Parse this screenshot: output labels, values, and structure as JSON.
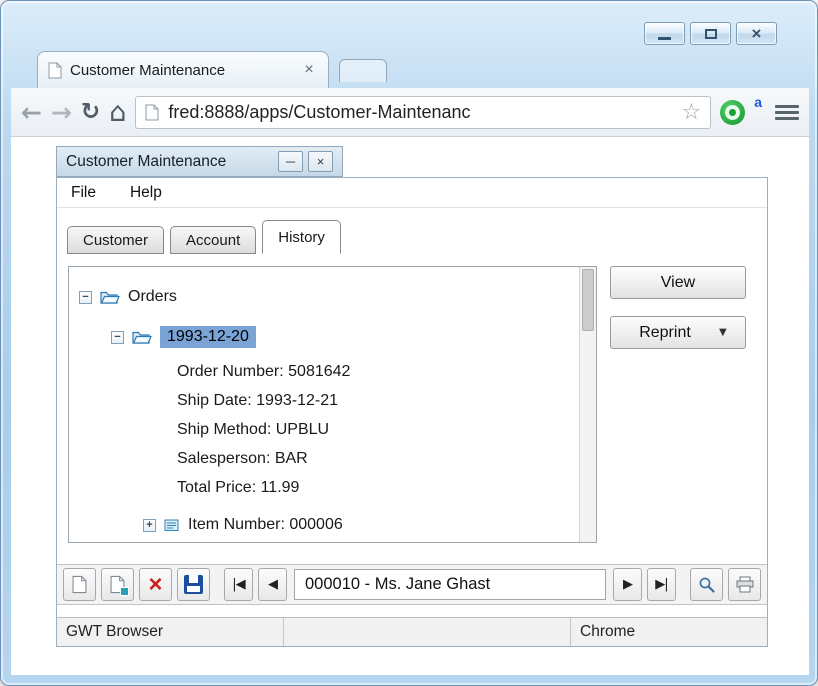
{
  "colors": {
    "selection_bg": "#7aa3d6",
    "delete_red": "#cf1d1d",
    "save_blue": "#1d4e9e",
    "folder_blue": "#2e7bb6",
    "extension_green": "#1aa035",
    "badge_blue": "#1b5cd8"
  },
  "icons": {
    "back": "←",
    "forward": "→",
    "reload": "↻",
    "home": "⌂",
    "star": "☆",
    "close_x": "×",
    "minimize": "─",
    "delete_x": "×",
    "dropdown_arrow": "▼",
    "tree_collapse": "−",
    "tree_expand": "+",
    "nav_first": "|◀",
    "nav_prev": "◀",
    "nav_next": "▶",
    "nav_last": "▶|"
  },
  "browser": {
    "tab_title": "Customer Maintenance",
    "url": "fred:8888/apps/Customer-Maintenanc",
    "badge": "a"
  },
  "app": {
    "title": "Customer Maintenance",
    "menu": [
      {
        "label": "File"
      },
      {
        "label": "Help"
      }
    ],
    "tabs": [
      {
        "label": "Customer"
      },
      {
        "label": "Account"
      },
      {
        "label": "History"
      }
    ],
    "active_tab": "History",
    "tree": {
      "root_label": "Orders",
      "selected_label": "1993-12-20",
      "details": [
        "Order Number: 5081642",
        "Ship Date: 1993-12-21",
        "Ship Method: UPBLU",
        "Salesperson: BAR",
        "Total Price: 11.99"
      ],
      "item_label": "Item Number: 000006"
    },
    "actions": {
      "view": "View",
      "reprint": "Reprint"
    },
    "record_field": "000010 - Ms. Jane Ghast",
    "status": {
      "left": "GWT Browser",
      "middle": "",
      "right": "Chrome"
    }
  }
}
